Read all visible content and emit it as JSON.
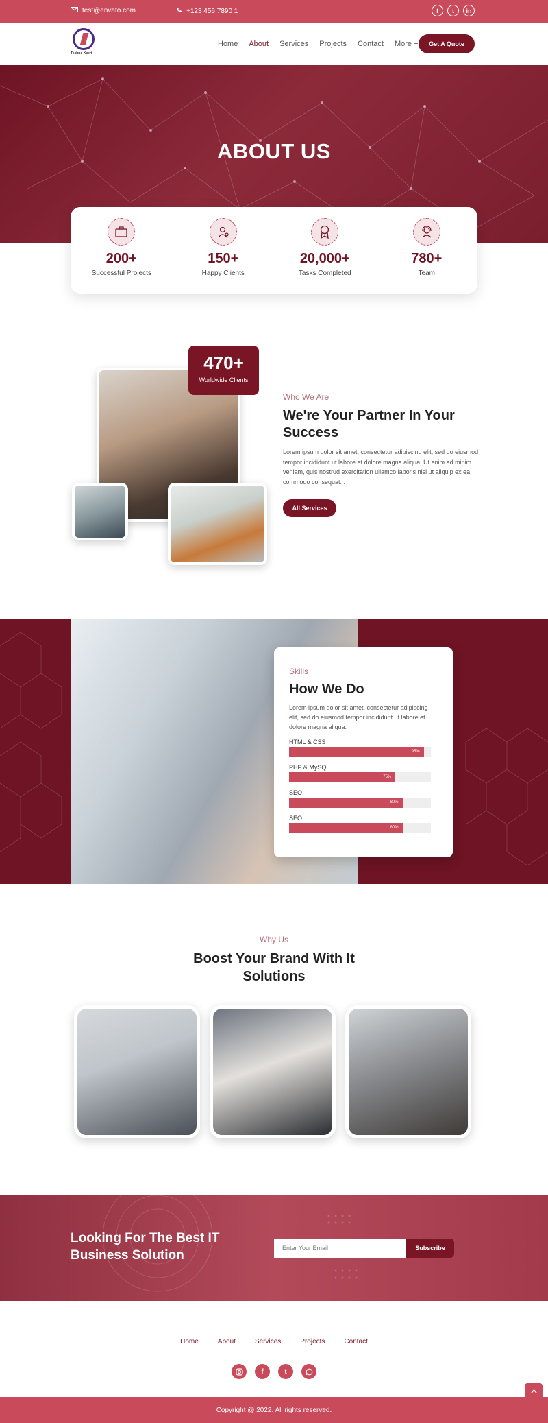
{
  "topbar": {
    "email": "test@envato.com",
    "phone": "+123 456 7890 1",
    "socials": [
      "facebook-icon",
      "twitter-icon",
      "linkedin-icon"
    ]
  },
  "brand": {
    "name": "Techno Xpert"
  },
  "nav": {
    "links": [
      "Home",
      "About",
      "Services",
      "Projects",
      "Contact",
      "More +"
    ],
    "active": "About",
    "cta": "Get A Quote"
  },
  "hero": {
    "title": "ABOUT US"
  },
  "stats": [
    {
      "icon": "briefcase-icon",
      "value": "200+",
      "label": "Successful Projects"
    },
    {
      "icon": "user-gear-icon",
      "value": "150+",
      "label": "Happy Clients"
    },
    {
      "icon": "award-icon",
      "value": "20,000+",
      "label": "Tasks Completed"
    },
    {
      "icon": "support-agent-icon",
      "value": "780+",
      "label": "Team"
    }
  ],
  "about": {
    "badge_value": "470+",
    "badge_label": "Worldwide Clients",
    "kicker": "Who We Are",
    "title": "We're Your Partner In Your Success",
    "body": "Lorem ipsum dolor sit amet, consectetur adipiscing elit, sed do eiusmod tempor incididunt ut labore et dolore magna aliqua. Ut enim ad minim veniam, quis nostrud exercitation ullamco laboris nisi ut aliquip ex ea commodo consequat. .",
    "button": "All Services"
  },
  "skills": {
    "kicker": "Skills",
    "title": "How We Do",
    "body": "Lorem ipsum dolor sit amet, consectetur adipiscing elit, sed do eiusmod tempor incididunt ut labore et dolore magna aliqua.",
    "items": [
      {
        "name": "HTML & CSS",
        "percent": 95,
        "label": "95%"
      },
      {
        "name": "PHP & MySQL",
        "percent": 75,
        "label": "75%"
      },
      {
        "name": "SEO",
        "percent": 80,
        "label": "80%"
      },
      {
        "name": "SEO",
        "percent": 80,
        "label": "80%"
      }
    ]
  },
  "why": {
    "kicker": "Why Us",
    "title": "Boost Your Brand With It Solutions"
  },
  "cta": {
    "title": "Looking For The Best IT Business Solution",
    "email_placeholder": "Enter Your Email",
    "button": "Subscribe"
  },
  "footer": {
    "links": [
      "Home",
      "About",
      "Services",
      "Projects",
      "Contact"
    ],
    "socials": [
      "instagram-icon",
      "facebook-icon",
      "twitter-icon",
      "whatsapp-icon"
    ],
    "copyright": "Copyright @ 2022. All rights reserved."
  },
  "colors": {
    "accent": "#c94a5a",
    "dark_accent": "#7a1526",
    "hero_bg": "#6e1424"
  }
}
